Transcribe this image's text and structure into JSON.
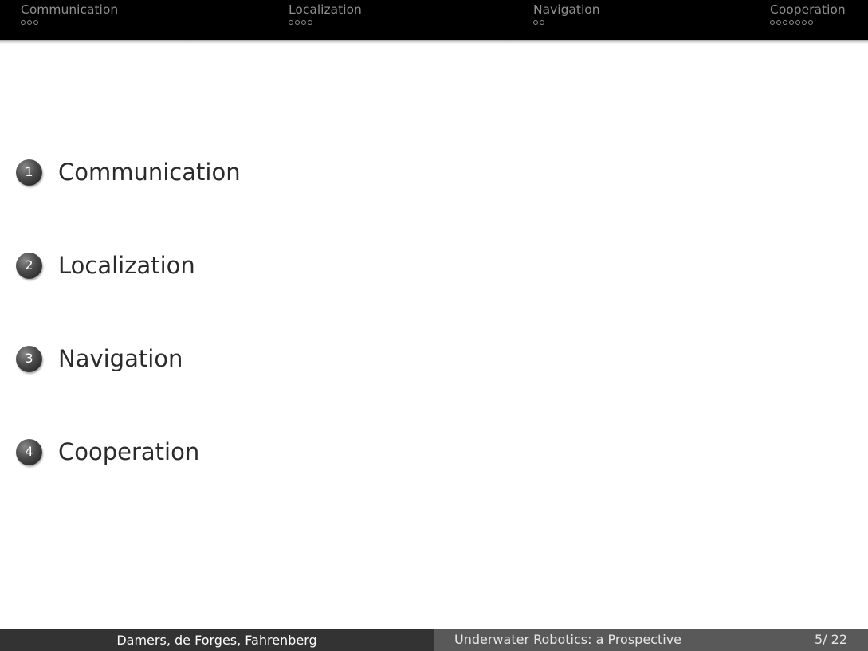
{
  "header": {
    "sections": [
      {
        "title": "Communication",
        "subsection_count": 3
      },
      {
        "title": "Localization",
        "subsection_count": 4
      },
      {
        "title": "Navigation",
        "subsection_count": 2
      },
      {
        "title": "Cooperation",
        "subsection_count": 7
      }
    ]
  },
  "toc": {
    "items": [
      {
        "number": "1",
        "label": "Communication"
      },
      {
        "number": "2",
        "label": "Localization"
      },
      {
        "number": "3",
        "label": "Navigation"
      },
      {
        "number": "4",
        "label": "Cooperation"
      }
    ]
  },
  "footer": {
    "authors": "Damers, de Forges, Fahrenberg",
    "title": "Underwater Robotics: a Prospective",
    "page": "5/ 22"
  },
  "colors": {
    "nav_background": "#000000",
    "nav_text": "#8f8f8f",
    "footer_left": "#333333",
    "footer_right": "#595959",
    "toc_text": "#2b2b2b"
  },
  "icons": {
    "subsection_marker": "circle-outline-icon",
    "toc_marker": "numbered-ball-icon"
  }
}
